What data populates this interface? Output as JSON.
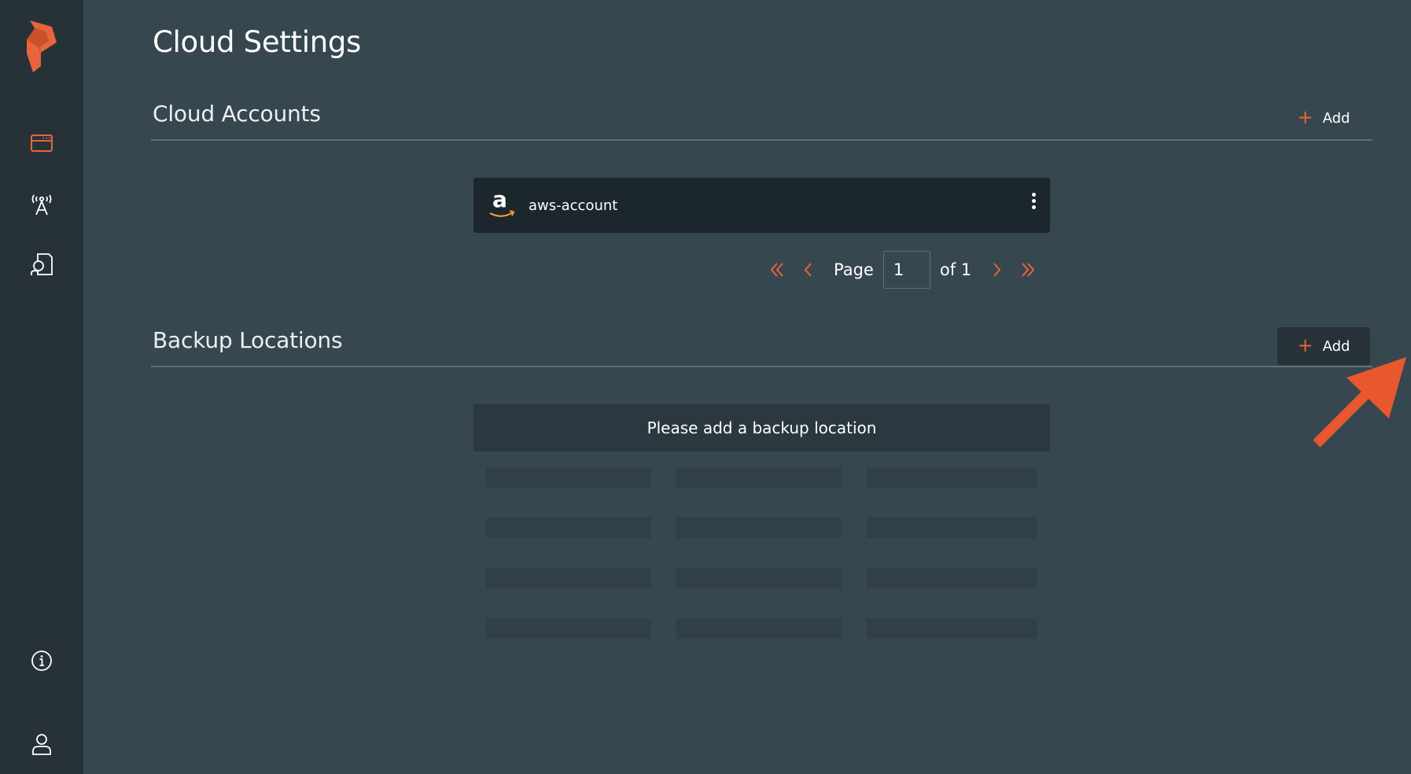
{
  "page": {
    "title": "Cloud Settings"
  },
  "sidebar": {
    "logo_icon": "portworx-logo-icon",
    "items": [
      {
        "icon": "cluster-icon"
      },
      {
        "icon": "broadcast-tower-icon"
      },
      {
        "icon": "migrate-document-icon"
      }
    ],
    "bottom": [
      {
        "icon": "info-icon"
      },
      {
        "icon": "user-icon"
      }
    ]
  },
  "cloud_accounts": {
    "title": "Cloud Accounts",
    "add_label": "Add",
    "accounts": [
      {
        "name": "aws-account",
        "provider_icon": "amazon-icon"
      }
    ],
    "pagination": {
      "page_label": "Page",
      "current_page": "1",
      "of_label": "of 1"
    }
  },
  "backup_locations": {
    "title": "Backup Locations",
    "add_label": "Add",
    "empty_message": "Please add a backup location"
  },
  "colors": {
    "accent": "#e8643a",
    "background": "#37474f",
    "sidebar": "#263238"
  }
}
